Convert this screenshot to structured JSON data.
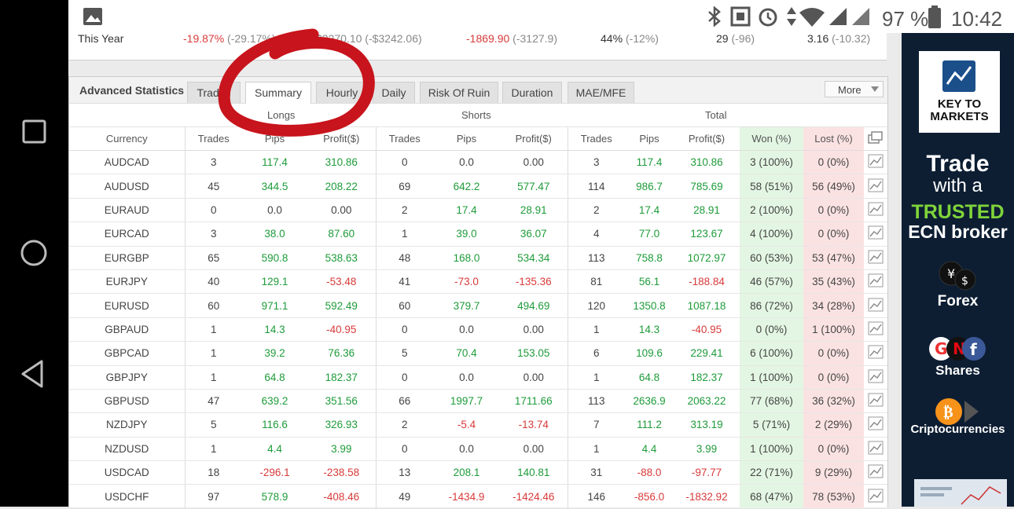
{
  "status_bar": {
    "battery": "97 %",
    "time": "10:42"
  },
  "year_row": {
    "label": "This Year",
    "pct": "-19.87%",
    "pct_prev": "(-29.17%)",
    "profit_prev": "$3270.10 (-$3242.06)",
    "pips": "-1869.90",
    "pips_prev": "(-3127.9)",
    "won": "44%",
    "won_prev": "(-12%)",
    "trades": "29",
    "trades_prev": "(-96)",
    "ratio": "3.16",
    "ratio_prev": "(-10.32)"
  },
  "advanced": {
    "title": "Advanced Statistics",
    "tabs": [
      "Trades",
      "Summary",
      "Hourly",
      "Daily",
      "Risk Of Ruin",
      "Duration",
      "MAE/MFE"
    ],
    "more": "More"
  },
  "groups": {
    "longs": "Longs",
    "shorts": "Shorts",
    "total": "Total"
  },
  "columns": [
    "Currency",
    "Trades",
    "Pips",
    "Profit($)",
    "Trades",
    "Pips",
    "Profit($)",
    "Trades",
    "Pips",
    "Profit($)",
    "Won (%)",
    "Lost (%)"
  ],
  "rows": [
    [
      "AUDCAD",
      "3",
      "117.4",
      "310.86",
      "0",
      "0.0",
      "0.00",
      "3",
      "117.4",
      "310.86",
      "3 (100%)",
      "0 (0%)"
    ],
    [
      "AUDUSD",
      "45",
      "344.5",
      "208.22",
      "69",
      "642.2",
      "577.47",
      "114",
      "986.7",
      "785.69",
      "58 (51%)",
      "56 (49%)"
    ],
    [
      "EURAUD",
      "0",
      "0.0",
      "0.00",
      "2",
      "17.4",
      "28.91",
      "2",
      "17.4",
      "28.91",
      "2 (100%)",
      "0 (0%)"
    ],
    [
      "EURCAD",
      "3",
      "38.0",
      "87.60",
      "1",
      "39.0",
      "36.07",
      "4",
      "77.0",
      "123.67",
      "4 (100%)",
      "0 (0%)"
    ],
    [
      "EURGBP",
      "65",
      "590.8",
      "538.63",
      "48",
      "168.0",
      "534.34",
      "113",
      "758.8",
      "1072.97",
      "60 (53%)",
      "53 (47%)"
    ],
    [
      "EURJPY",
      "40",
      "129.1",
      "-53.48",
      "41",
      "-73.0",
      "-135.36",
      "81",
      "56.1",
      "-188.84",
      "46 (57%)",
      "35 (43%)"
    ],
    [
      "EURUSD",
      "60",
      "971.1",
      "592.49",
      "60",
      "379.7",
      "494.69",
      "120",
      "1350.8",
      "1087.18",
      "86 (72%)",
      "34 (28%)"
    ],
    [
      "GBPAUD",
      "1",
      "14.3",
      "-40.95",
      "0",
      "0.0",
      "0.00",
      "1",
      "14.3",
      "-40.95",
      "0 (0%)",
      "1 (100%)"
    ],
    [
      "GBPCAD",
      "1",
      "39.2",
      "76.36",
      "5",
      "70.4",
      "153.05",
      "6",
      "109.6",
      "229.41",
      "6 (100%)",
      "0 (0%)"
    ],
    [
      "GBPJPY",
      "1",
      "64.8",
      "182.37",
      "0",
      "0.0",
      "0.00",
      "1",
      "64.8",
      "182.37",
      "1 (100%)",
      "0 (0%)"
    ],
    [
      "GBPUSD",
      "47",
      "639.2",
      "351.56",
      "66",
      "1997.7",
      "1711.66",
      "113",
      "2636.9",
      "2063.22",
      "77 (68%)",
      "36 (32%)"
    ],
    [
      "NZDJPY",
      "5",
      "116.6",
      "326.93",
      "2",
      "-5.4",
      "-13.74",
      "7",
      "111.2",
      "313.19",
      "5 (71%)",
      "2 (29%)"
    ],
    [
      "NZDUSD",
      "1",
      "4.4",
      "3.99",
      "0",
      "0.0",
      "0.00",
      "1",
      "4.4",
      "3.99",
      "1 (100%)",
      "0 (0%)"
    ],
    [
      "USDCAD",
      "18",
      "-296.1",
      "-238.58",
      "13",
      "208.1",
      "140.81",
      "31",
      "-88.0",
      "-97.77",
      "22 (71%)",
      "9 (29%)"
    ],
    [
      "USDCHF",
      "97",
      "578.9",
      "-408.46",
      "49",
      "-1434.9",
      "-1424.46",
      "146",
      "-856.0",
      "-1832.92",
      "68 (47%)",
      "78 (53%)"
    ]
  ],
  "ad": {
    "logo_line1": "KEY TO",
    "logo_line2": "MARKETS",
    "headline1": "Trade",
    "headline2": "with a",
    "headline3": "TRUSTED",
    "headline4": "ECN broker",
    "item1": "Forex",
    "item2": "Shares",
    "item3": "Criptocurrencies",
    "accent": "#7fd43a"
  }
}
